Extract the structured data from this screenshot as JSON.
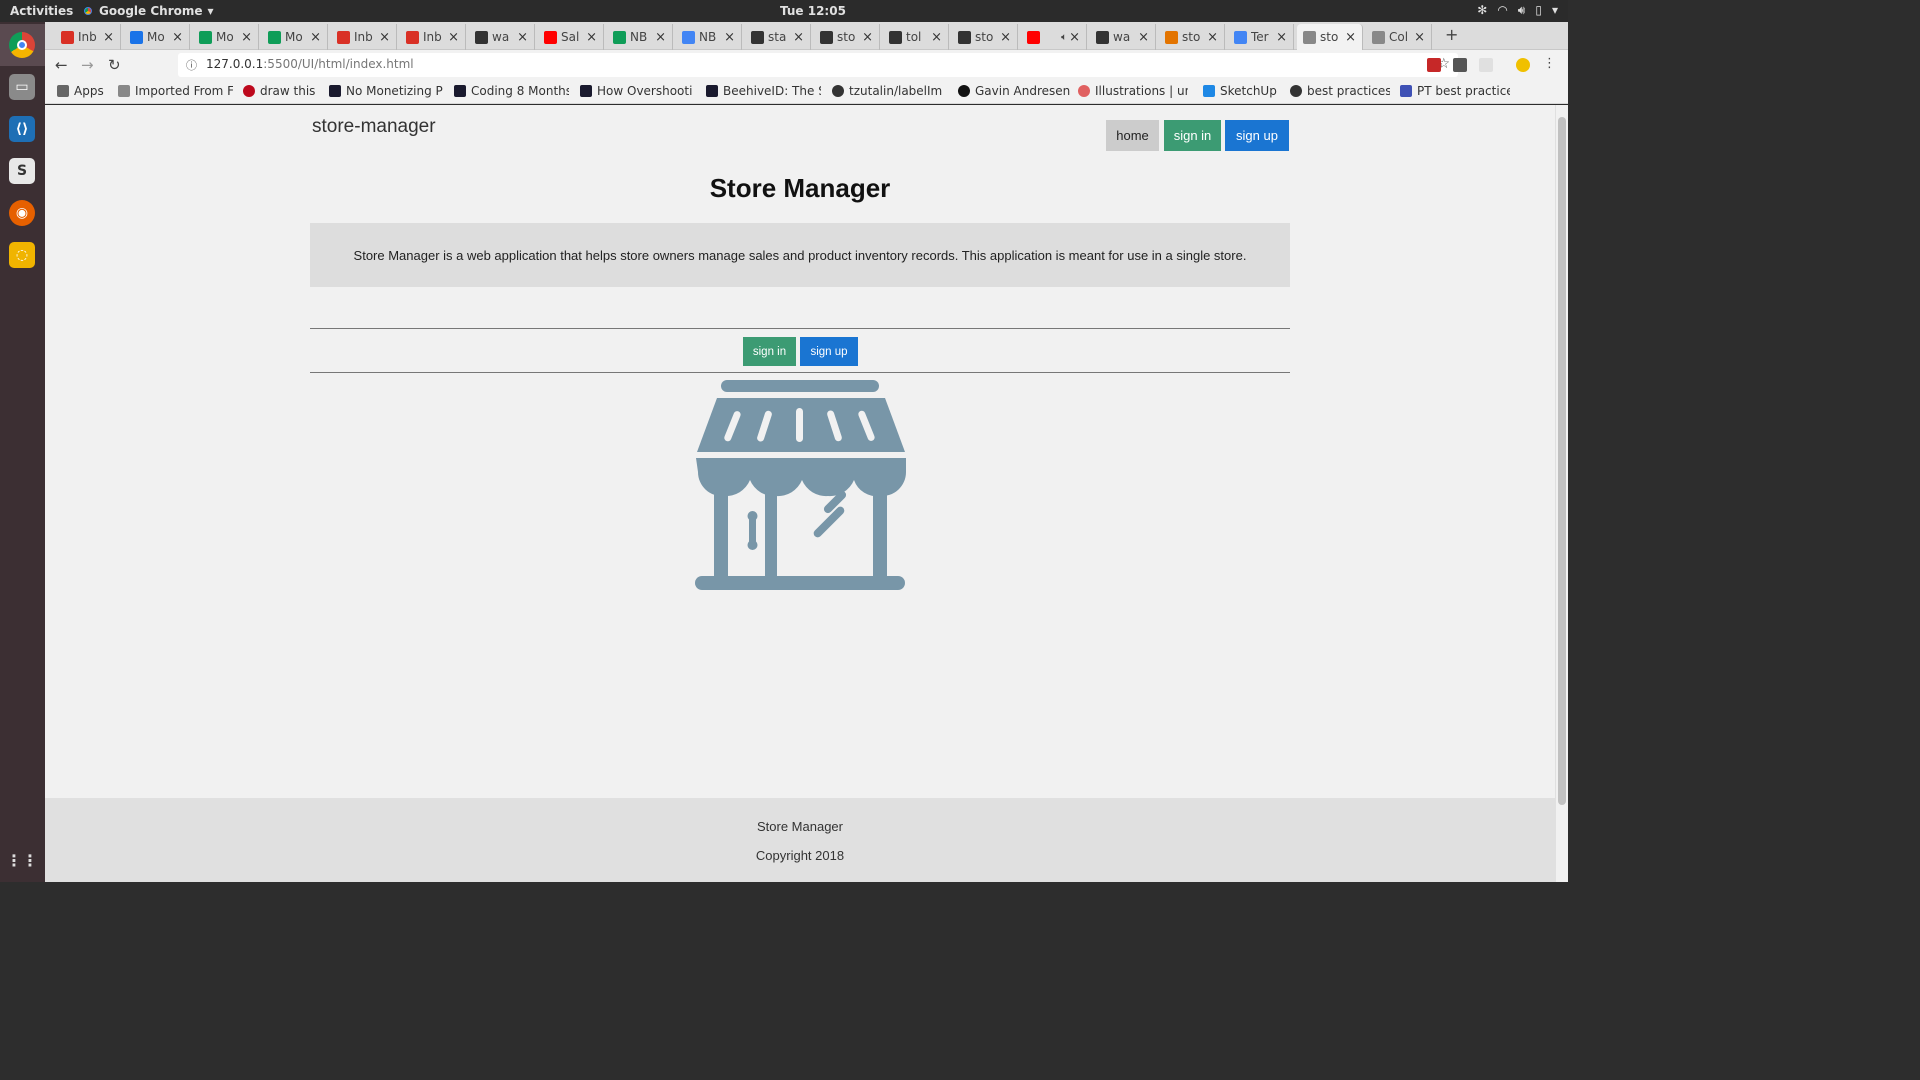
{
  "system": {
    "activities": "Activities",
    "app_name": "Google Chrome",
    "clock": "Tue 12:05"
  },
  "tabs": [
    {
      "title": "Inb"
    },
    {
      "title": "Mo"
    },
    {
      "title": "Mo"
    },
    {
      "title": "Mo"
    },
    {
      "title": "Inb"
    },
    {
      "title": "Inb"
    },
    {
      "title": "wa"
    },
    {
      "title": "Sal"
    },
    {
      "title": "NB"
    },
    {
      "title": "NB"
    },
    {
      "title": "sta"
    },
    {
      "title": "sto"
    },
    {
      "title": "tol"
    },
    {
      "title": "sto"
    },
    {
      "title": ""
    },
    {
      "title": "wa"
    },
    {
      "title": "sto"
    },
    {
      "title": "Ter"
    },
    {
      "title": "sto"
    },
    {
      "title": "Col"
    }
  ],
  "address": {
    "url_host": "127.0.0.1",
    "url_rest": ":5500/UI/html/index.html"
  },
  "bookmarks": [
    {
      "label": "Apps"
    },
    {
      "label": "Imported From F"
    },
    {
      "label": "draw this"
    },
    {
      "label": "No Monetizing P"
    },
    {
      "label": "Coding 8 Months"
    },
    {
      "label": "How Overshooti"
    },
    {
      "label": "BeehiveID: The S"
    },
    {
      "label": "tzutalin/labelIm"
    },
    {
      "label": "Gavin Andresen"
    },
    {
      "label": "Illustrations | un"
    },
    {
      "label": "SketchUp"
    },
    {
      "label": "best practices"
    },
    {
      "label": "PT best practice"
    }
  ],
  "site": {
    "brand": "store-manager",
    "nav": {
      "home": "home",
      "sign_in": "sign in",
      "sign_up": "sign up"
    },
    "heading": "Store Manager",
    "description": "Store Manager is a web application that helps store owners manage sales and product inventory records. This application is meant for use in a single store.",
    "cta": {
      "sign_in": "sign in",
      "sign_up": "sign up"
    },
    "footer": {
      "name": "Store Manager",
      "copyright": "Copyright 2018"
    }
  },
  "colors": {
    "sign_in": "#3c9b73",
    "sign_up": "#1a75d2",
    "home": "#cccccc",
    "store_icon": "#7896a8"
  }
}
